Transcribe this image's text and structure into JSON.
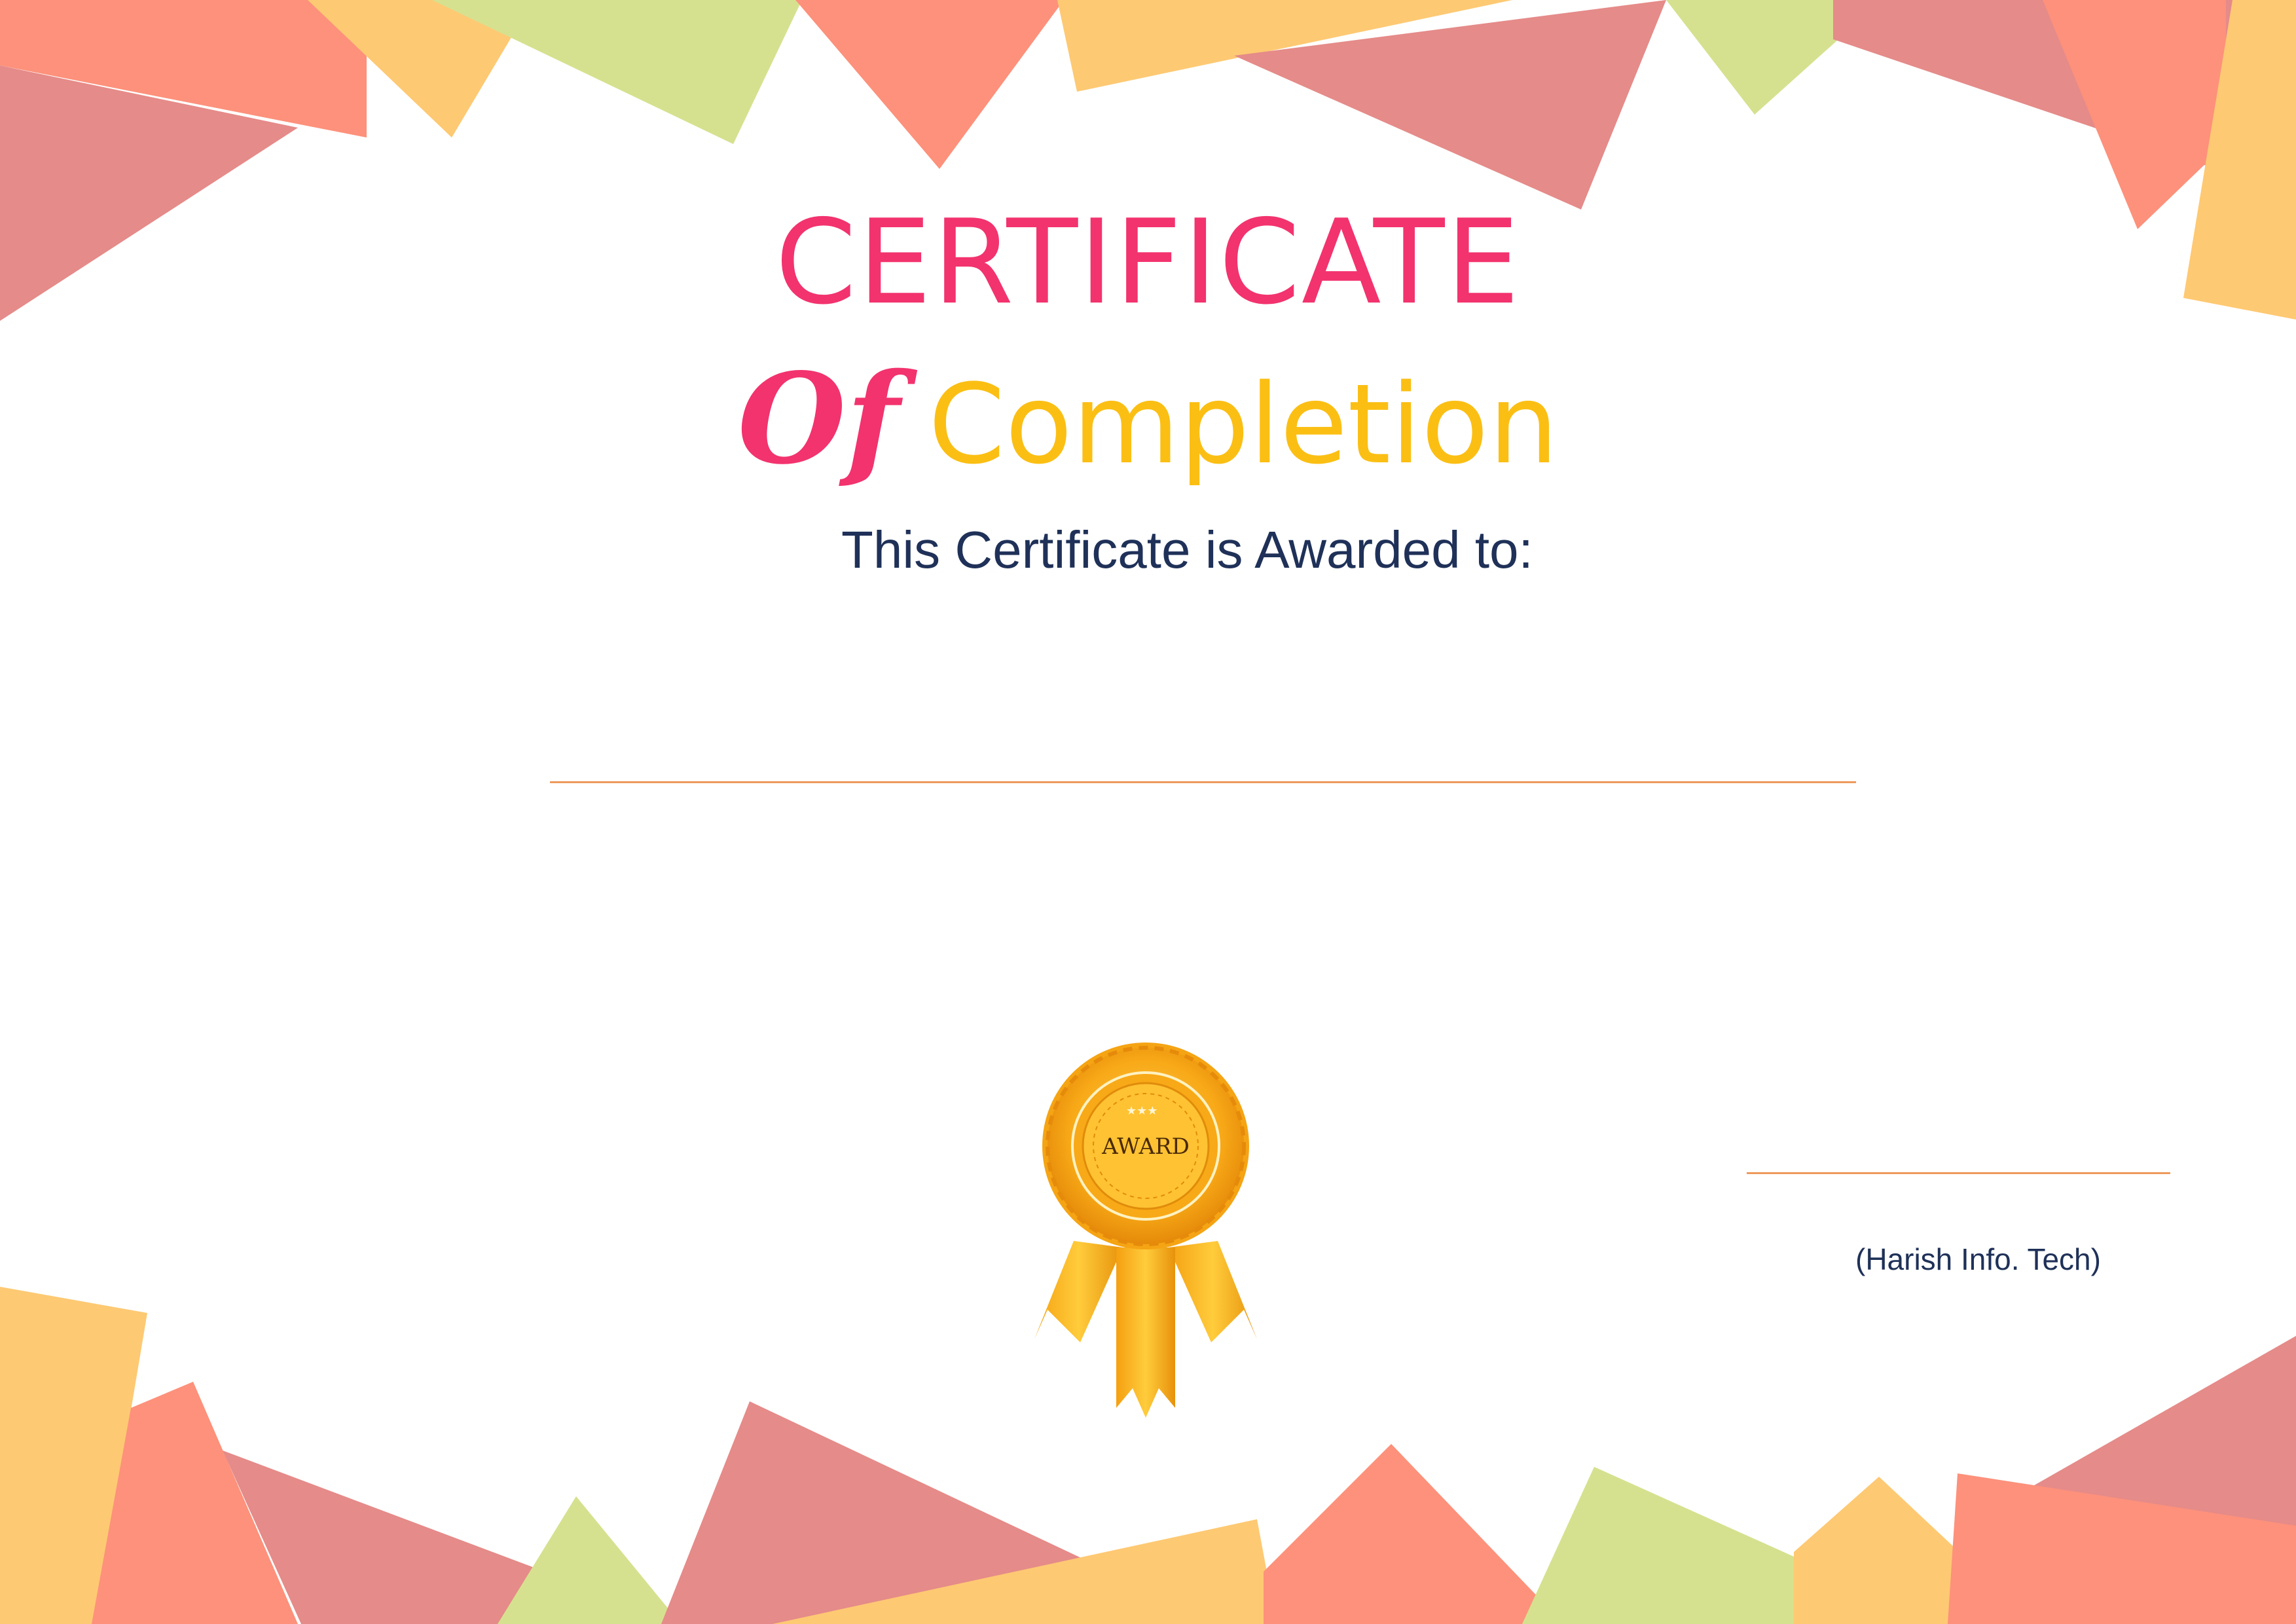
{
  "certificate": {
    "title": "CERTIFICATE",
    "title_of": "Of",
    "title_completion": "Completion",
    "awarded_to_text": "This Certificate is Awarded to:",
    "signatory_text": "(Harish Info. Tech)",
    "badge_text": "AWARD"
  },
  "colors": {
    "title_pink": "#f2336e",
    "title_yellow": "#fbbf14",
    "body_navy": "#1f3158",
    "line_orange": "#ee9a5c",
    "decor_coral": "#fd917b",
    "decor_rose": "#e58b89",
    "decor_peach": "#fec973",
    "decor_green": "#d6e18f"
  },
  "decorations": {
    "badge_icon": "award-rosette-icon"
  }
}
